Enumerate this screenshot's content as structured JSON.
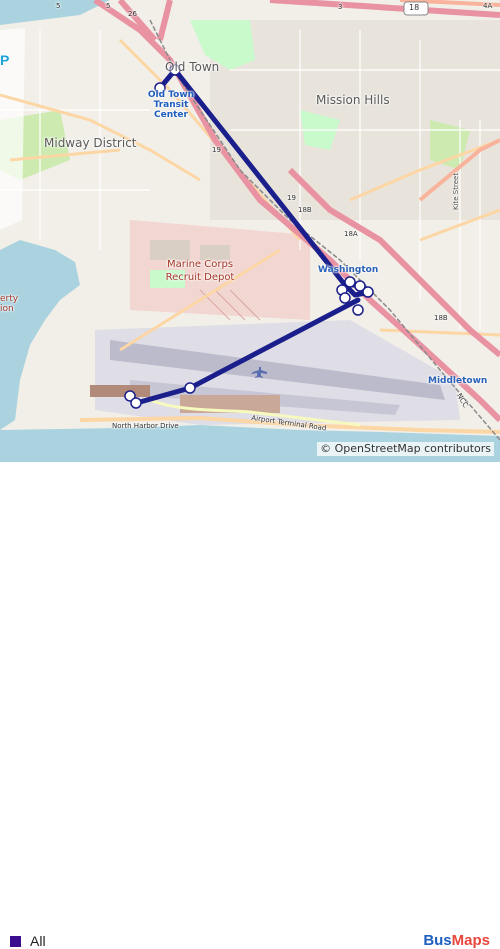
{
  "map": {
    "labels": {
      "old_town": "Old Town",
      "old_town_transit_center": "Old Town Transit Center",
      "midway_district": "Midway District",
      "mission_hills": "Mission Hills",
      "marine_corps_recruit_depot": "Marine Corps Recruit Depot",
      "washington": "Washington",
      "middletown": "Middletown",
      "north_harbor_drive": "North Harbor Drive",
      "airport_terminal_road": "Airport Terminal Road",
      "kite_street": "Kite Street",
      "left_cut_text": "erty\nion",
      "cut_letter": "P"
    },
    "route_labels": {
      "i5_a": "5",
      "i5_b": "5",
      "r18_top": "18",
      "r26": "26",
      "r3": "3",
      "r4a": "4A",
      "r19a": "19",
      "r19b": "19",
      "r18b_a": "18B",
      "r18a": "18A",
      "r18b_b": "18B",
      "ncc": "NCC"
    },
    "colors": {
      "route": "#1a1f8c",
      "stop_fill": "#ffffff",
      "water": "#aad3df",
      "land": "#f2efe9",
      "motorway": "#e892a2",
      "trunk": "#f9b29c",
      "primary": "#fcd6a4",
      "runway": "#bbbbcc",
      "military": "#f2d6d1",
      "park": "#c8facc"
    },
    "route_stops_count_visible": true
  },
  "attribution": "© OpenStreetMap contributors",
  "legend": {
    "swatch_color": "#3b0e8f",
    "label": "All"
  },
  "brand": {
    "part1": "Bus",
    "part2": "Maps"
  }
}
